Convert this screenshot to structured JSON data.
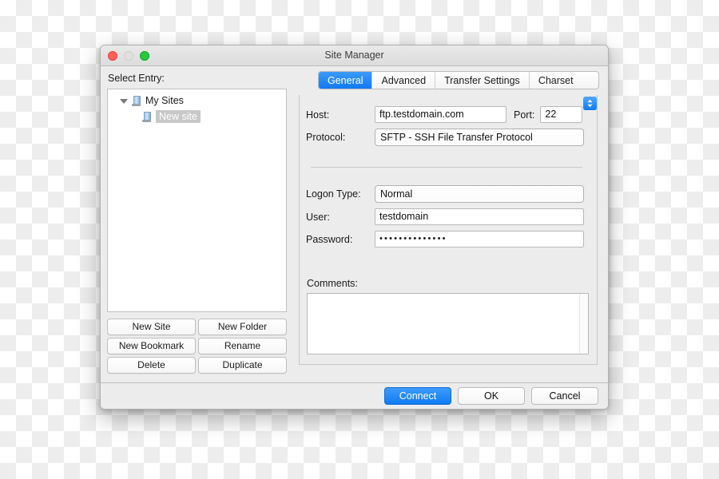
{
  "window": {
    "title": "Site Manager",
    "traffic_lights": [
      "close-button",
      "minimize-button",
      "zoom-button"
    ]
  },
  "left_pane": {
    "label": "Select Entry:",
    "tree": [
      {
        "label": "My Sites",
        "level": 0,
        "expanded": true,
        "icon": "server-icon",
        "selected": false
      },
      {
        "label": "New site",
        "level": 1,
        "expanded": false,
        "icon": "server-icon",
        "selected": true
      }
    ],
    "buttons": [
      "New Site",
      "New Folder",
      "New Bookmark",
      "Rename",
      "Delete",
      "Duplicate"
    ]
  },
  "right_pane": {
    "tabs": [
      {
        "label": "General",
        "active": true
      },
      {
        "label": "Advanced",
        "active": false
      },
      {
        "label": "Transfer Settings",
        "active": false
      },
      {
        "label": "Charset",
        "active": false
      }
    ],
    "general": {
      "host_label": "Host:",
      "host_value": "ftp.testdomain.com",
      "host_placeholder": "",
      "port_label": "Port:",
      "port_value": "22",
      "port_placeholder": "",
      "protocol_label": "Protocol:",
      "protocol_value": "SFTP - SSH File Transfer Protocol",
      "logon_type_label": "Logon Type:",
      "logon_type_value": "Normal",
      "user_label": "User:",
      "user_value": "testdomain",
      "user_placeholder": "",
      "password_label": "Password:",
      "password_value": "••••••••••••••",
      "comments_label": "Comments:",
      "comments_value": ""
    }
  },
  "footer": {
    "connect_label": "Connect",
    "ok_label": "OK",
    "cancel_label": "Cancel"
  },
  "background": {
    "chevron_glyph": "›"
  },
  "colors": {
    "accent_blue": "#0f7bf3",
    "window_chrome": "#ececec",
    "close_red": "#ff5f57",
    "minimize_gray": "#e0e0e0",
    "zoom_green": "#28c840",
    "selection_gray": "#c8c8c8"
  }
}
